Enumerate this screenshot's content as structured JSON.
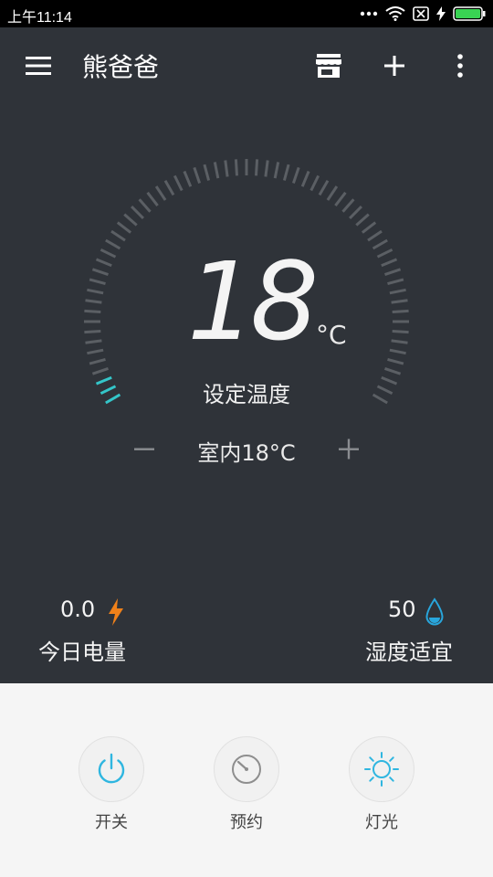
{
  "status_bar": {
    "time": "上午11:14"
  },
  "app_bar": {
    "title": "熊爸爸",
    "icons": [
      "menu-icon",
      "store-icon",
      "add-icon",
      "more-icon"
    ]
  },
  "thermostat": {
    "set_temperature": "18",
    "unit": "°C",
    "set_label": "设定温度",
    "indoor_text": "室内18°C",
    "accent_color": "#34c6c9"
  },
  "stats": {
    "power": {
      "value": "0.0",
      "label": "今日电量",
      "icon": "lightning-icon",
      "color": "#f0811a"
    },
    "humidity": {
      "value": "50",
      "label": "湿度适宜",
      "icon": "water-drop-icon",
      "color": "#28a6dc"
    }
  },
  "controls": [
    {
      "label": "开关",
      "icon": "power-icon"
    },
    {
      "label": "预约",
      "icon": "timer-icon"
    },
    {
      "label": "灯光",
      "icon": "light-icon"
    }
  ]
}
